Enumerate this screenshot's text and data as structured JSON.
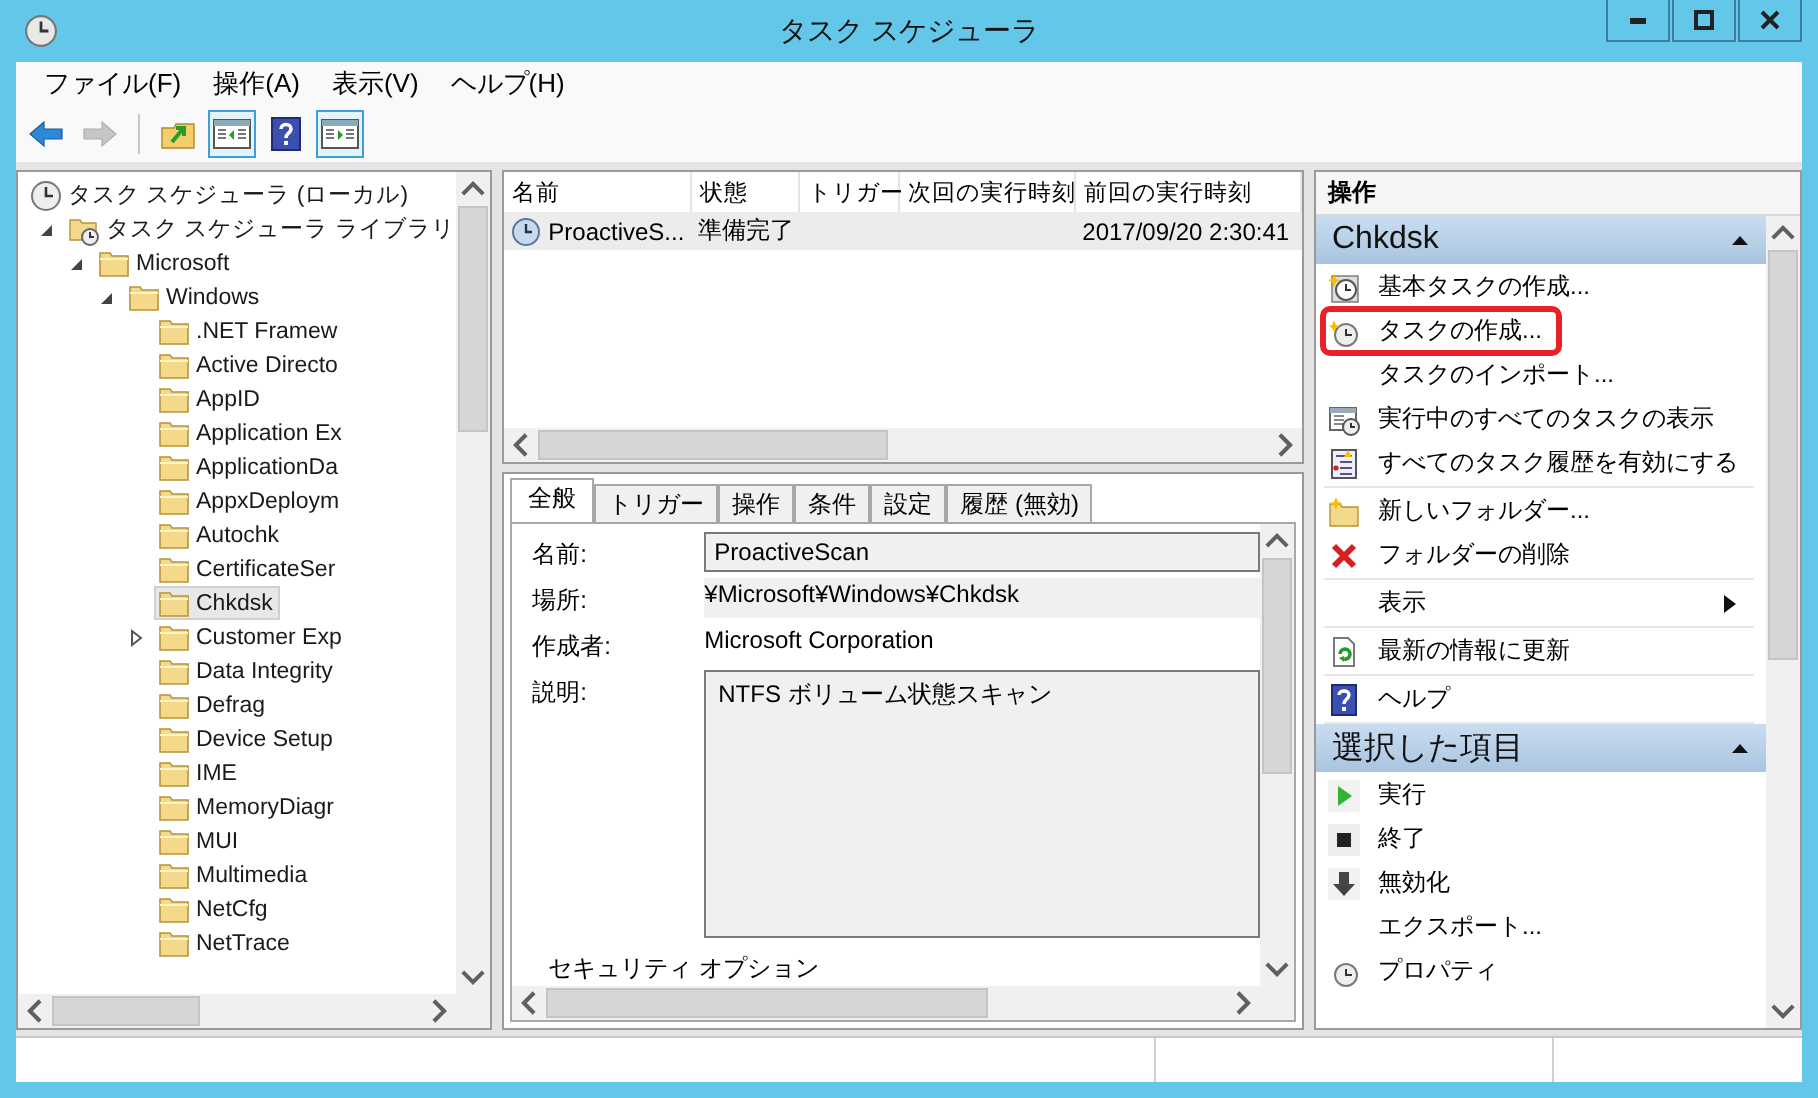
{
  "window": {
    "title": "タスク スケジューラ"
  },
  "menu": [
    "ファイル(F)",
    "操作(A)",
    "表示(V)",
    "ヘルプ(H)"
  ],
  "toolbar": [
    [
      {
        "kind": "back",
        "pressed": false,
        "disabled": false
      },
      {
        "kind": "forward",
        "pressed": false,
        "disabled": true
      }
    ],
    [
      {
        "kind": "up",
        "pressed": false,
        "disabled": false
      },
      {
        "kind": "console-tree",
        "pressed": true,
        "disabled": false
      },
      {
        "kind": "help",
        "pressed": false,
        "disabled": false
      },
      {
        "kind": "action-pane",
        "pressed": true,
        "disabled": false
      }
    ]
  ],
  "tree": [
    {
      "label": "タスク スケジューラ (ローカル)",
      "kind": "scheduler",
      "selected": false,
      "children": [
        {
          "label": "タスク スケジューラ ライブラリ",
          "kind": "library",
          "expanded": true,
          "selected": false,
          "children": [
            {
              "label": "Microsoft",
              "kind": "folder",
              "expanded": true,
              "selected": false,
              "children": [
                {
                  "label": "Windows",
                  "kind": "folder",
                  "expanded": true,
                  "selected": false,
                  "children": [
                    {
                      "label": ".NET Framew",
                      "kind": "folder",
                      "selected": false
                    },
                    {
                      "label": "Active Directo",
                      "kind": "folder",
                      "selected": false
                    },
                    {
                      "label": "AppID",
                      "kind": "folder",
                      "selected": false
                    },
                    {
                      "label": "Application Ex",
                      "kind": "folder",
                      "selected": false
                    },
                    {
                      "label": "ApplicationDa",
                      "kind": "folder",
                      "selected": false
                    },
                    {
                      "label": "AppxDeploym",
                      "kind": "folder",
                      "selected": false
                    },
                    {
                      "label": "Autochk",
                      "kind": "folder",
                      "selected": false
                    },
                    {
                      "label": "CertificateSer",
                      "kind": "folder",
                      "selected": false
                    },
                    {
                      "label": "Chkdsk",
                      "kind": "folder",
                      "selected": true
                    },
                    {
                      "label": "Customer Exp",
                      "kind": "folder",
                      "expanded": false,
                      "selected": false
                    },
                    {
                      "label": "Data Integrity",
                      "kind": "folder",
                      "selected": false
                    },
                    {
                      "label": "Defrag",
                      "kind": "folder",
                      "selected": false
                    },
                    {
                      "label": "Device Setup",
                      "kind": "folder",
                      "selected": false
                    },
                    {
                      "label": "IME",
                      "kind": "folder",
                      "selected": false
                    },
                    {
                      "label": "MemoryDiagr",
                      "kind": "folder",
                      "selected": false
                    },
                    {
                      "label": "MUI",
                      "kind": "folder",
                      "selected": false
                    },
                    {
                      "label": "Multimedia",
                      "kind": "folder",
                      "selected": false
                    },
                    {
                      "label": "NetCfg",
                      "kind": "folder",
                      "selected": false
                    },
                    {
                      "label": "NetTrace",
                      "kind": "folder",
                      "selected": false
                    }
                  ]
                }
              ]
            }
          ]
        }
      ]
    }
  ],
  "task_list": {
    "columns": [
      "名前",
      "状態",
      "トリガー",
      "次回の実行時刻",
      "前回の実行時刻"
    ],
    "rows": [
      {
        "name": "ProactiveS...",
        "status": "準備完了",
        "last_run": "2017/09/20 2:30:41",
        "selected": true
      }
    ]
  },
  "details": {
    "tabs": [
      {
        "label": "全般",
        "selected": true
      },
      {
        "label": "トリガー",
        "selected": false
      },
      {
        "label": "操作",
        "selected": false
      },
      {
        "label": "条件",
        "selected": false
      },
      {
        "label": "設定",
        "selected": false
      },
      {
        "label": "履歴 (無効)",
        "selected": false
      }
    ],
    "fields": [
      {
        "label": "名前:",
        "value": "ProactiveScan",
        "kind": "input"
      },
      {
        "label": "場所:",
        "value": "¥Microsoft¥Windows¥Chkdsk",
        "kind": "readonly"
      },
      {
        "label": "作成者:",
        "value": "Microsoft Corporation",
        "kind": "text"
      },
      {
        "label": "説明:",
        "value": "NTFS ボリューム状態スキャン",
        "kind": "textarea"
      }
    ],
    "section_label": "セキュリティ オプション"
  },
  "actions": {
    "title": "操作",
    "sections": [
      {
        "title": "Chkdsk",
        "expanded": true,
        "groups": [
          [
            {
              "label": "基本タスクの作成...",
              "kind": "basic-task",
              "highlighted": false
            },
            {
              "label": "タスクの作成...",
              "kind": "create-task",
              "highlighted": true
            },
            {
              "label": "タスクのインポート...",
              "kind": "plain",
              "highlighted": false
            },
            {
              "label": "実行中のすべてのタスクの表示",
              "kind": "running",
              "highlighted": false
            },
            {
              "label": "すべてのタスク履歴を有効にする",
              "kind": "history",
              "highlighted": false
            }
          ],
          [
            {
              "label": "新しいフォルダー...",
              "kind": "new-folder",
              "highlighted": false
            },
            {
              "label": "フォルダーの削除",
              "kind": "delete",
              "highlighted": false
            }
          ],
          [
            {
              "label": "表示",
              "kind": "submenu",
              "highlighted": false
            }
          ],
          [
            {
              "label": "最新の情報に更新",
              "kind": "refresh",
              "highlighted": false
            }
          ],
          [
            {
              "label": "ヘルプ",
              "kind": "help",
              "highlighted": false
            }
          ]
        ]
      },
      {
        "title": "選択した項目",
        "expanded": true,
        "groups": [
          [
            {
              "label": "実行",
              "kind": "run",
              "highlighted": false
            },
            {
              "label": "終了",
              "kind": "stop",
              "highlighted": false
            },
            {
              "label": "無効化",
              "kind": "disable",
              "highlighted": false
            },
            {
              "label": "エクスポート...",
              "kind": "plain",
              "highlighted": false
            },
            {
              "label": "プロパティ",
              "kind": "properties",
              "highlighted": false
            }
          ]
        ]
      }
    ]
  }
}
